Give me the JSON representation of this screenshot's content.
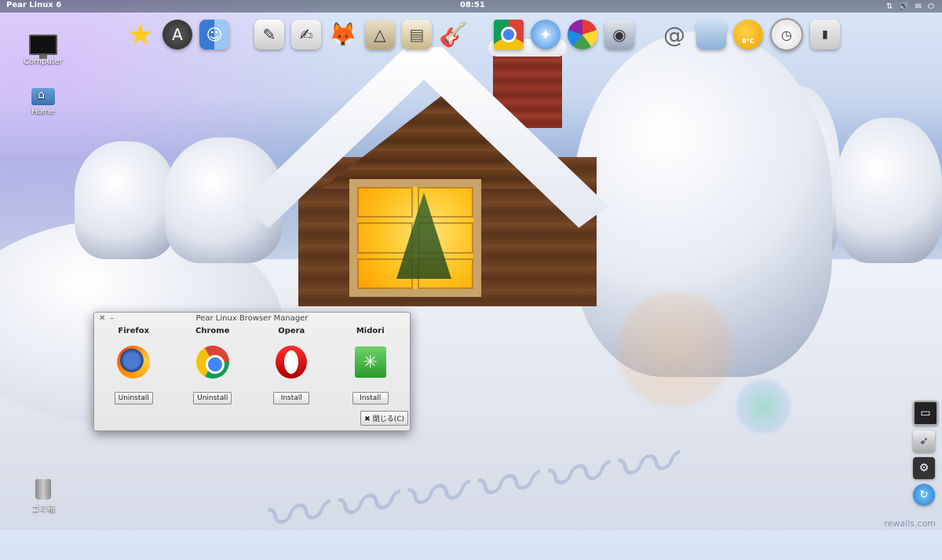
{
  "top_panel": {
    "app_name": "Pear Linux 6",
    "clock": "08:51"
  },
  "dock": {
    "weather_temp": "8°C",
    "items": [
      {
        "icon": "star-icon"
      },
      {
        "icon": "app-store-icon"
      },
      {
        "icon": "finder-icon"
      },
      {
        "icon": "text-editor-icon"
      },
      {
        "icon": "notes-icon"
      },
      {
        "icon": "gimp-icon"
      },
      {
        "icon": "draw-icon"
      },
      {
        "icon": "archive-icon"
      },
      {
        "icon": "guitar-icon"
      },
      {
        "icon": "chrome-icon"
      },
      {
        "icon": "safari-icon"
      },
      {
        "icon": "picasa-icon"
      },
      {
        "icon": "camera-icon"
      },
      {
        "icon": "mail-icon"
      },
      {
        "icon": "folder-icon"
      },
      {
        "icon": "weather-icon"
      },
      {
        "icon": "clock-icon"
      },
      {
        "icon": "switch-icon"
      }
    ]
  },
  "desktop": {
    "computer_label": "Computer",
    "home_label": "Home",
    "trash_label": "ゴミ箱"
  },
  "dialog": {
    "title": "Pear Linux Browser Manager",
    "close_label": "閉じる(C)",
    "browsers": [
      {
        "name": "Firefox",
        "action": "Uninstall"
      },
      {
        "name": "Chrome",
        "action": "Uninstall"
      },
      {
        "name": "Opera",
        "action": "Install"
      },
      {
        "name": "Midori",
        "action": "Install"
      }
    ]
  },
  "wallpaper": {
    "watermark": "rewalls.com"
  }
}
